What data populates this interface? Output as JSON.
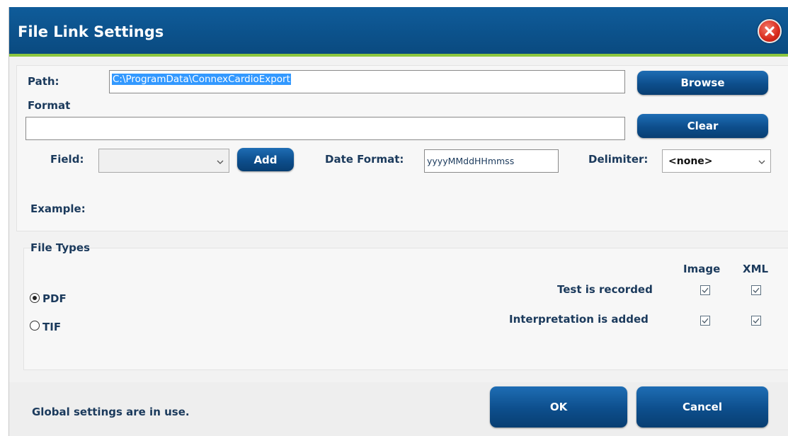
{
  "dialog": {
    "title": "File Link Settings"
  },
  "path": {
    "label": "Path:",
    "value": "C:\\ProgramData\\ConnexCardioExport",
    "browse_label": "Browse"
  },
  "format": {
    "label": "Format",
    "value": "",
    "clear_label": "Clear",
    "field_label": "Field:",
    "field_value": "",
    "add_label": "Add",
    "date_format_label": "Date Format:",
    "date_format_value": "yyyyMMddHHmmss",
    "delimiter_label": "Delimiter:",
    "delimiter_value": "<none>",
    "example_label": "Example:"
  },
  "file_types": {
    "label": "File Types",
    "options": [
      {
        "label": "PDF",
        "selected": true
      },
      {
        "label": "TIF",
        "selected": false
      }
    ],
    "columns": [
      "Image",
      "XML"
    ],
    "rows": [
      {
        "label": "Test is recorded",
        "image": true,
        "xml": true
      },
      {
        "label": "Interpretation is added",
        "image": true,
        "xml": true
      }
    ]
  },
  "footer": {
    "status": "Global settings are in use.",
    "ok_label": "OK",
    "cancel_label": "Cancel"
  },
  "colors": {
    "titlebar": "#0a4a80",
    "accent_strip": "#8cc63f",
    "button": "#0d4e8c",
    "label_text": "#1b3a5c"
  },
  "icons": {
    "close": "close-icon",
    "dropdown": "chevron-down-icon",
    "check": "check-icon"
  }
}
